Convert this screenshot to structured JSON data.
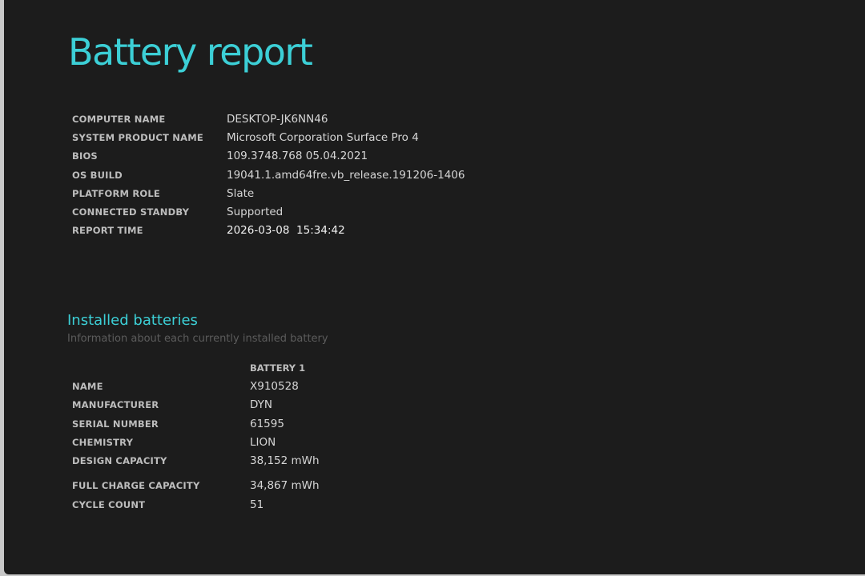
{
  "title": "Battery report",
  "system_info": [
    {
      "label": "COMPUTER NAME",
      "value": "DESKTOP-JK6NN46"
    },
    {
      "label": "SYSTEM PRODUCT NAME",
      "value": "Microsoft Corporation Surface Pro 4"
    },
    {
      "label": "BIOS",
      "value": "109.3748.768 05.04.2021"
    },
    {
      "label": "OS BUILD",
      "value": "19041.1.amd64fre.vb_release.191206-1406"
    },
    {
      "label": "PLATFORM ROLE",
      "value": "Slate"
    },
    {
      "label": "CONNECTED STANDBY",
      "value": "Supported"
    },
    {
      "label": "REPORT TIME",
      "value": "2026-03-08  15:34:42"
    }
  ],
  "installed_batteries": {
    "title": "Installed batteries",
    "subtitle": "Information about each currently installed battery",
    "column_header": "BATTERY 1",
    "rows": [
      {
        "label": "NAME",
        "value": "X910528"
      },
      {
        "label": "MANUFACTURER",
        "value": "DYN"
      },
      {
        "label": "SERIAL NUMBER",
        "value": "61595"
      },
      {
        "label": "CHEMISTRY",
        "value": "LION"
      },
      {
        "label": "DESIGN CAPACITY",
        "value": "38,152 mWh"
      },
      {
        "label": "FULL CHARGE CAPACITY",
        "value": "34,867 mWh"
      },
      {
        "label": "CYCLE COUNT",
        "value": "51"
      }
    ]
  },
  "colors": {
    "background": "#1c1c1c",
    "accent": "#3ccfd6",
    "label": "#bdbdbd",
    "value": "#d6d6d6",
    "muted": "#5c5c5c"
  }
}
